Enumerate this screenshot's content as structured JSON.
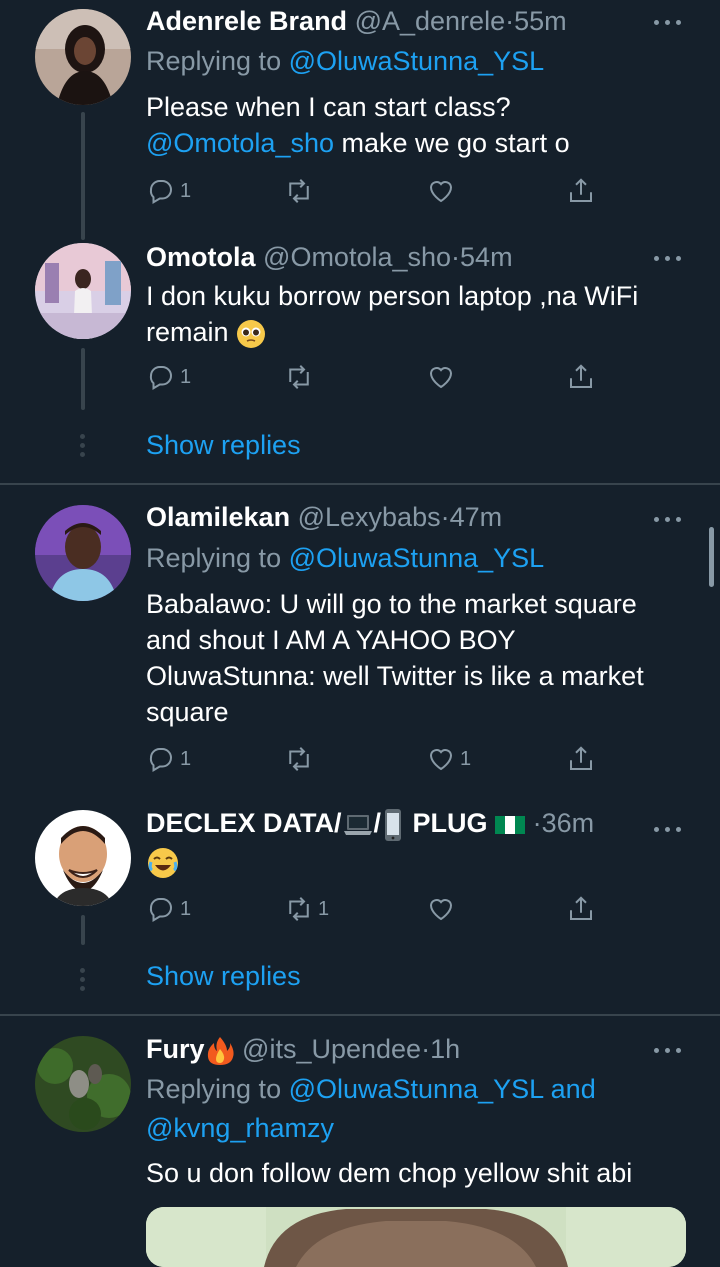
{
  "tweets": [
    {
      "name": "Adenrele Brand",
      "handle": "@A_denrele",
      "sep": "·",
      "time": "55m",
      "replying_prefix": "Replying to ",
      "replying_to": "@OluwaStunna_YSL",
      "text_line1": "Please when I can start class?",
      "mention": "@Omotola_sho",
      "text_line2_rest": " make we go start o",
      "reply_count": "1",
      "retweet_count": "",
      "like_count": ""
    },
    {
      "name": "Omotola",
      "handle": "@Omotola_sho",
      "sep": "·",
      "time": "54m",
      "text_line1": "I don kuku borrow person laptop ,na WiFi",
      "text_line2": "remain",
      "emoji": "pleading-face",
      "reply_count": "1",
      "retweet_count": "",
      "like_count": "",
      "show_replies": "Show replies"
    },
    {
      "name": "Olamilekan",
      "handle": "@Lexybabs",
      "sep": "·",
      "time": "47m",
      "replying_prefix": "Replying to ",
      "replying_to": "@OluwaStunna_YSL",
      "lines": [
        "Babalawo: U will go to the market square",
        "and shout I AM A YAHOO BOY",
        "OluwaStunna: well Twitter is like a market",
        "square"
      ],
      "reply_count": "1",
      "retweet_count": "",
      "like_count": "1"
    },
    {
      "name_part1": "DECLEX DATA/",
      "name_sep": "/",
      "name_part2": "PLUG",
      "sep": "·",
      "time": "36m",
      "emoji": "laughing-face",
      "reply_count": "1",
      "retweet_count": "1",
      "like_count": "",
      "show_replies": "Show replies"
    },
    {
      "name": "Fury",
      "handle": "@its_Upendee",
      "sep": "·",
      "time": "1h",
      "replying_prefix": "Replying to ",
      "replying_to": "@OluwaStunna_YSL",
      "replying_and": " and",
      "replying_to2": "@kvng_rhamzy",
      "text_line1": "So u don follow dem chop yellow shit abi"
    }
  ],
  "icons": {
    "reply": "reply-icon",
    "retweet": "retweet-icon",
    "like": "heart-icon",
    "share": "share-icon",
    "more": "more-icon"
  },
  "colors": {
    "background": "#15202b",
    "secondary_text": "#8899a6",
    "link": "#1da1f2",
    "divider": "#38444d"
  }
}
